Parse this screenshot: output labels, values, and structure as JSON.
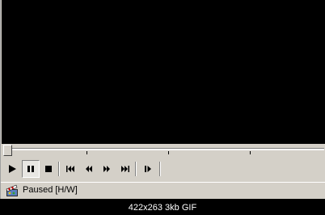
{
  "player": {
    "status_text": "Paused [H/W]",
    "state": "paused",
    "seek_position": 0.0
  },
  "toolbar": {
    "buttons": [
      {
        "name": "play",
        "icon": "play-icon"
      },
      {
        "name": "pause",
        "icon": "pause-icon",
        "pressed": true
      },
      {
        "name": "stop",
        "icon": "stop-icon"
      },
      {
        "name": "previous",
        "icon": "skip-back-icon"
      },
      {
        "name": "rewind",
        "icon": "rewind-icon"
      },
      {
        "name": "fast-forward",
        "icon": "fast-forward-icon"
      },
      {
        "name": "next",
        "icon": "skip-forward-icon"
      },
      {
        "name": "frame-step",
        "icon": "frame-step-icon"
      }
    ]
  },
  "caption": {
    "text": "422x263 3kb GIF"
  },
  "colors": {
    "background": "#000000",
    "chrome": "#d4d0c8",
    "text": "#000000",
    "caption_text": "#ffffff"
  }
}
